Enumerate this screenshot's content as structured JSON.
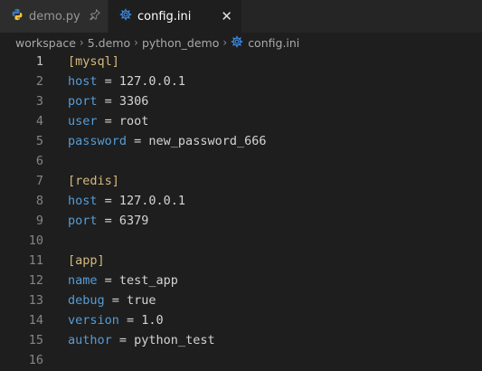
{
  "colors": {
    "background": "#1e1e1e",
    "section": "#d7ba7d",
    "key": "#569cd6",
    "text": "#d4d4d4",
    "line_number": "#858585"
  },
  "tabs": [
    {
      "label": "demo.py",
      "icon": "python-icon",
      "state": "inactive",
      "pinned": true
    },
    {
      "label": "config.ini",
      "icon": "gear-icon",
      "state": "active"
    }
  ],
  "breadcrumb": [
    "workspace",
    "5.demo",
    "python_demo",
    "config.ini"
  ],
  "editor": {
    "lines": [
      {
        "n": "1",
        "type": "section",
        "text": "[mysql]"
      },
      {
        "n": "2",
        "type": "kv",
        "key": "host",
        "value": "127.0.0.1"
      },
      {
        "n": "3",
        "type": "kv",
        "key": "port",
        "value": "3306"
      },
      {
        "n": "4",
        "type": "kv",
        "key": "user",
        "value": "root"
      },
      {
        "n": "5",
        "type": "kv",
        "key": "password",
        "value": "new_password_666"
      },
      {
        "n": "6",
        "type": "blank"
      },
      {
        "n": "7",
        "type": "section",
        "text": "[redis]"
      },
      {
        "n": "8",
        "type": "kv",
        "key": "host",
        "value": "127.0.0.1"
      },
      {
        "n": "9",
        "type": "kv",
        "key": "port",
        "value": "6379"
      },
      {
        "n": "10",
        "type": "blank"
      },
      {
        "n": "11",
        "type": "section",
        "text": "[app]"
      },
      {
        "n": "12",
        "type": "kv",
        "key": "name",
        "value": "test_app"
      },
      {
        "n": "13",
        "type": "kv",
        "key": "debug",
        "value": "true"
      },
      {
        "n": "14",
        "type": "kv",
        "key": "version",
        "value": "1.0"
      },
      {
        "n": "15",
        "type": "kv",
        "key": "author",
        "value": "python_test"
      },
      {
        "n": "16",
        "type": "blank"
      }
    ]
  }
}
